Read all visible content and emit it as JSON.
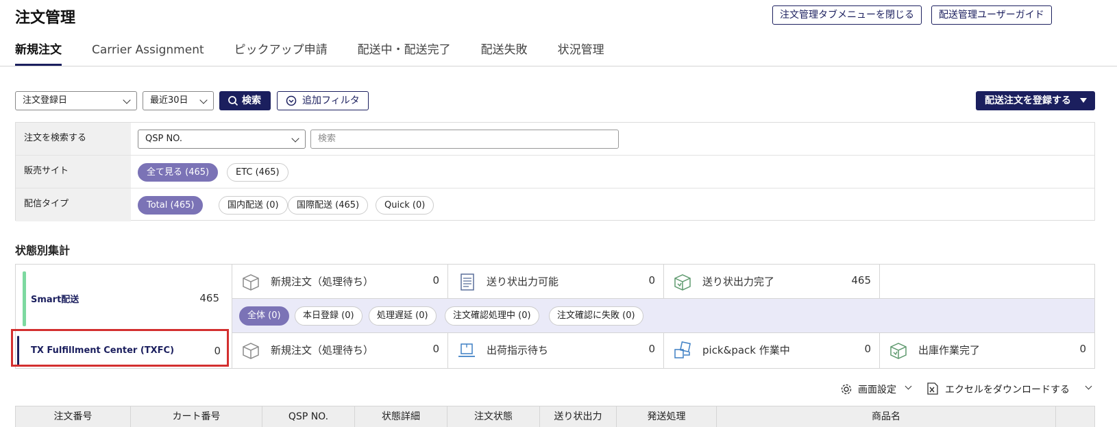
{
  "page": {
    "title": "注文管理",
    "close_tab_menu_label": "注文管理タブメニューを閉じる",
    "guide_label": "配送管理ユーザーガイド"
  },
  "tabs": [
    {
      "label": "新規注文",
      "active": true
    },
    {
      "label": "Carrier Assignment",
      "active": false
    },
    {
      "label": "ピックアップ申請",
      "active": false
    },
    {
      "label": "配送中・配送完了",
      "active": false
    },
    {
      "label": "配送失敗",
      "active": false
    },
    {
      "label": "状況管理",
      "active": false
    }
  ],
  "toolbar": {
    "date_type": "注文登録日",
    "date_range": "最近30日",
    "search_label": "検索",
    "add_filter_label": "追加フィルタ",
    "register_label": "配送注文を登録する"
  },
  "filters": {
    "search": {
      "label": "注文を検索する",
      "field": "QSP NO.",
      "placeholder": "検索"
    },
    "site": {
      "label": "販売サイト",
      "options": [
        "全て見る (465)",
        "ETC (465)"
      ]
    },
    "delivery_type": {
      "label": "配信タイプ",
      "options": [
        "Total (465)",
        "国内配送 (0)",
        "国際配送 (465)",
        "Quick (0)"
      ]
    }
  },
  "summary": {
    "title": "状態別集計",
    "smart": {
      "name": "Smart配送",
      "count": "465",
      "stats": [
        {
          "label": "新規注文（処理待ち）",
          "value": "0",
          "icon": "box-icon"
        },
        {
          "label": "送り状出力可能",
          "value": "0",
          "icon": "invoice-icon"
        },
        {
          "label": "送り状出力完了",
          "value": "465",
          "icon": "box-check-icon"
        }
      ],
      "sub_filters": [
        "全体 (0)",
        "本日登録 (0)",
        "処理遅延 (0)",
        "注文確認処理中 (0)",
        "注文確認に失敗 (0)"
      ]
    },
    "txfc": {
      "name": "TX Fulfillment Center (TXFC)",
      "count": "0",
      "stats": [
        {
          "label": "新規注文（処理待ち）",
          "value": "0",
          "icon": "box-icon"
        },
        {
          "label": "出荷指示待ち",
          "value": "0",
          "icon": "laptop-icon"
        },
        {
          "label": "pick&pack 作業中",
          "value": "0",
          "icon": "packing-icon"
        },
        {
          "label": "出庫作業完了",
          "value": "0",
          "icon": "box-check-icon"
        }
      ]
    }
  },
  "list_tools": {
    "screen_settings": "画面設定",
    "excel_download": "エクセルをダウンロードする"
  },
  "table": {
    "columns": [
      "注文番号",
      "カート番号",
      "QSP NO.",
      "状態詳細",
      "注文状態",
      "送り状出力",
      "発送処理",
      "商品名"
    ]
  }
}
